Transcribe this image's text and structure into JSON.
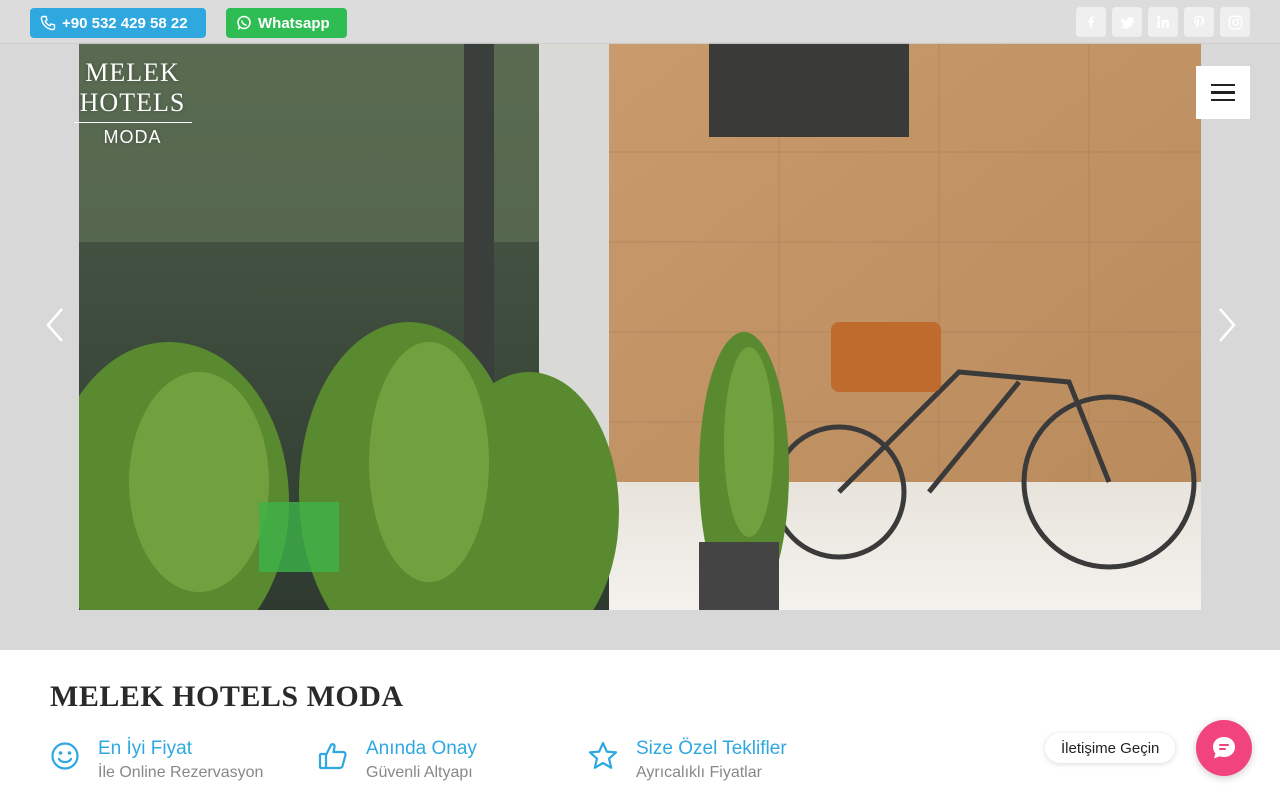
{
  "topbar": {
    "phone_label": "+90 532 429 58 22",
    "whatsapp_label": "Whatsapp",
    "social": [
      {
        "icon": "facebook-icon",
        "glyph": "f"
      },
      {
        "icon": "twitter-icon",
        "glyph": "t"
      },
      {
        "icon": "linkedin-icon",
        "glyph": "in"
      },
      {
        "icon": "pinterest-icon",
        "glyph": "p"
      },
      {
        "icon": "instagram-icon",
        "glyph": "ig"
      }
    ]
  },
  "logo": {
    "brand": "MELEK HOTELS",
    "sub": "MODA"
  },
  "hero": {
    "prev_icon": "chevron-left-icon",
    "next_icon": "chevron-right-icon"
  },
  "main": {
    "title": "MELEK HOTELS MODA",
    "features": [
      {
        "icon": "smiley-icon",
        "title": "En İyi Fiyat",
        "subtitle": "İle Online Rezervasyon"
      },
      {
        "icon": "thumbs-up-icon",
        "title": "Anında Onay",
        "subtitle": "Güvenli Altyapı"
      },
      {
        "icon": "star-icon",
        "title": "Size Özel Teklifler",
        "subtitle": "Ayrıcalıklı Fiyatlar"
      }
    ]
  },
  "contact": {
    "label": "İletişime Geçin"
  },
  "colors": {
    "accent_blue": "#2fa8e0",
    "whatsapp_green": "#2ebd52",
    "contact_pink": "#f1437d"
  }
}
